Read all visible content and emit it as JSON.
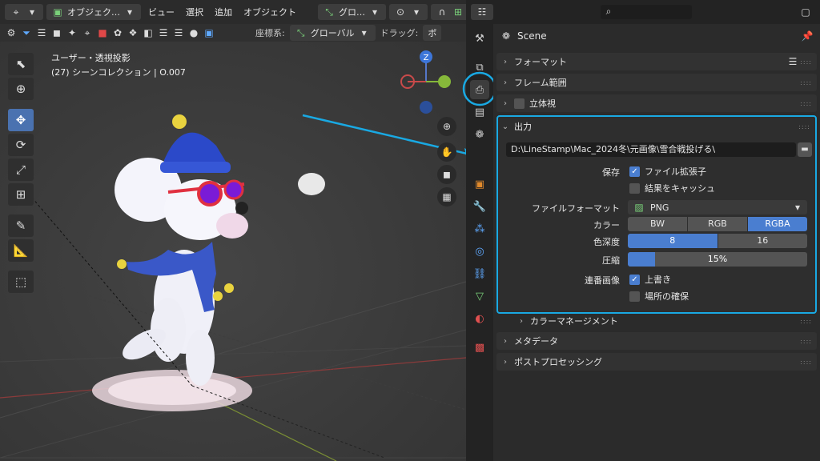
{
  "viewport": {
    "header": {
      "mode_label": "オブジェク…",
      "menus": [
        "ビュー",
        "選択",
        "追加",
        "オブジェクト"
      ],
      "transform_label": "グロ…"
    },
    "header2": {
      "coord_label": "座標系:",
      "coord_value": "グローバル",
      "drag_label": "ドラッグ:",
      "drag_value": "ボ"
    },
    "overlay": {
      "view_name": "ユーザー・透視投影",
      "collection": "(27) シーンコレクション | O.007"
    },
    "gizmo": {
      "z_label": "Z"
    }
  },
  "properties": {
    "scene_name": "Scene",
    "panels": {
      "format": "フォーマット",
      "frame_range": "フレーム範囲",
      "stereoscopy": "立体視",
      "output": "出力",
      "color_management": "カラーマネージメント",
      "metadata": "メタデータ",
      "post_processing": "ポストプロセッシング"
    },
    "output": {
      "path": "D:\\LineStamp\\Mac_2024冬\\元画像\\雪合戦投げる\\",
      "save_label": "保存",
      "file_ext_label": "ファイル拡張子",
      "file_ext_checked": true,
      "cache_label": "結果をキャッシュ",
      "cache_checked": false,
      "format_label": "ファイルフォーマット",
      "format_value": "PNG",
      "color_label": "カラー",
      "color_options": [
        "BW",
        "RGB",
        "RGBA"
      ],
      "color_selected": "RGBA",
      "depth_label": "色深度",
      "depth_options": [
        "8",
        "16"
      ],
      "depth_selected": "8",
      "compression_label": "圧縮",
      "compression_value": "15%",
      "compression_fraction": 0.15,
      "sequence_label": "連番画像",
      "overwrite_label": "上書き",
      "overwrite_checked": true,
      "placeholder_label": "場所の確保",
      "placeholder_checked": false
    }
  },
  "colors": {
    "highlight": "#19a9e3",
    "accent_blue": "#4a7ed0",
    "active_tool": "#4a72b0"
  }
}
